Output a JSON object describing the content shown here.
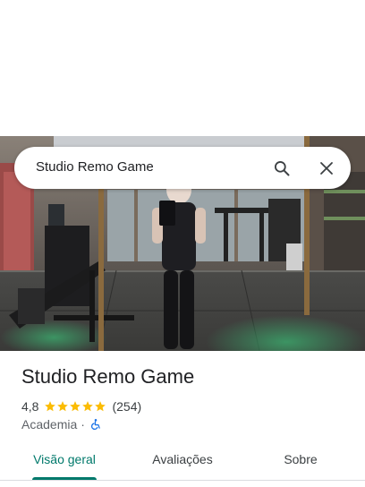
{
  "search": {
    "query": "Studio Remo Game",
    "search_icon": "search-icon",
    "clear_icon": "close-icon"
  },
  "place": {
    "name": "Studio Remo Game",
    "rating": "4,8",
    "stars": 5,
    "review_count": "(254)",
    "category": "Academia",
    "separator": "·",
    "accessibility_icon": "wheelchair-icon"
  },
  "tabs": [
    {
      "label": "Visão geral",
      "active": true
    },
    {
      "label": "Avaliações",
      "active": false
    },
    {
      "label": "Sobre",
      "active": false
    }
  ],
  "colors": {
    "accent": "#00796b",
    "star": "#fbbc04",
    "accessibility": "#1a73e8"
  }
}
